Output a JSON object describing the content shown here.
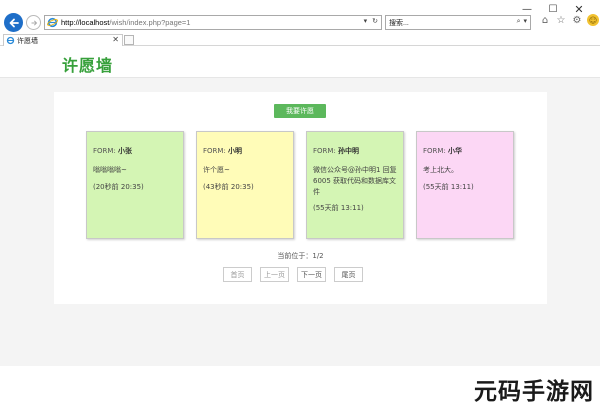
{
  "browser": {
    "url_host": "http://localhost",
    "url_path": "/wish/index.php?page=1",
    "search_placeholder": "搜索...",
    "tab_title": "许愿墙",
    "addr_dropdown": "▾",
    "addr_refresh": "↻",
    "search_glyph": "⌕",
    "search_dropdown": "▾"
  },
  "window": {
    "minimize": "—",
    "maximize": "☐",
    "close": "✕"
  },
  "toolbar": {
    "home": "⌂",
    "favorites": "☆",
    "settings": "⚙",
    "feedback": "☺"
  },
  "site": {
    "title": "许愿墙"
  },
  "actions": {
    "wish_button": "我要许愿"
  },
  "notes": [
    {
      "from_label": "FORM:",
      "name": "小张",
      "content": "嗡嗡嗡嗡~",
      "time": "(20秒前 20:35)",
      "color": "#d4f5b4"
    },
    {
      "from_label": "FORM:",
      "name": "小明",
      "content": "许个愿~",
      "time": "(43秒前 20:35)",
      "color": "#fffcb8"
    },
    {
      "from_label": "FORM:",
      "name": "孙中明",
      "content": "微信公众号@孙中明1 回复6005 获取代码和数据库文件",
      "time": "(55天前 13:11)",
      "color": "#d4f5b4"
    },
    {
      "from_label": "FORM:",
      "name": "小华",
      "content": "考上北大。",
      "time": "(55天前 13:11)",
      "color": "#fcd7f5"
    }
  ],
  "pagination": {
    "label": "当前位于：",
    "current": "1/2",
    "first": "首页",
    "prev": "上一页",
    "next": "下一页",
    "last": "尾页"
  },
  "colors": {
    "accent": "#37a03b",
    "button": "#5cb85c",
    "browser_blue": "#1e6ec8"
  },
  "watermark": "元码手游网"
}
